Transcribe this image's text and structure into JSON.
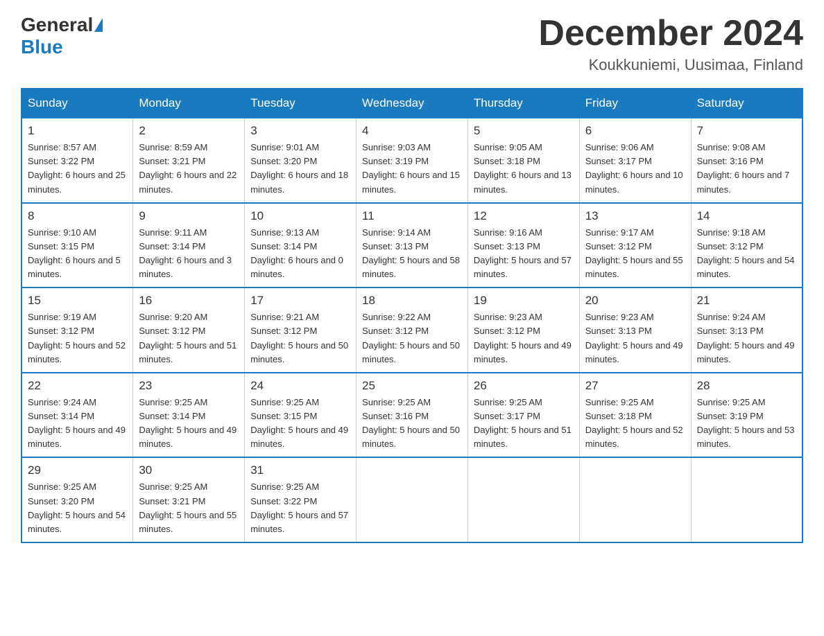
{
  "header": {
    "logo": {
      "general": "General",
      "blue": "Blue"
    },
    "title": "December 2024",
    "location": "Koukkuniemi, Uusimaa, Finland"
  },
  "days_of_week": [
    "Sunday",
    "Monday",
    "Tuesday",
    "Wednesday",
    "Thursday",
    "Friday",
    "Saturday"
  ],
  "weeks": [
    [
      {
        "day": "1",
        "sunrise": "8:57 AM",
        "sunset": "3:22 PM",
        "daylight": "6 hours and 25 minutes."
      },
      {
        "day": "2",
        "sunrise": "8:59 AM",
        "sunset": "3:21 PM",
        "daylight": "6 hours and 22 minutes."
      },
      {
        "day": "3",
        "sunrise": "9:01 AM",
        "sunset": "3:20 PM",
        "daylight": "6 hours and 18 minutes."
      },
      {
        "day": "4",
        "sunrise": "9:03 AM",
        "sunset": "3:19 PM",
        "daylight": "6 hours and 15 minutes."
      },
      {
        "day": "5",
        "sunrise": "9:05 AM",
        "sunset": "3:18 PM",
        "daylight": "6 hours and 13 minutes."
      },
      {
        "day": "6",
        "sunrise": "9:06 AM",
        "sunset": "3:17 PM",
        "daylight": "6 hours and 10 minutes."
      },
      {
        "day": "7",
        "sunrise": "9:08 AM",
        "sunset": "3:16 PM",
        "daylight": "6 hours and 7 minutes."
      }
    ],
    [
      {
        "day": "8",
        "sunrise": "9:10 AM",
        "sunset": "3:15 PM",
        "daylight": "6 hours and 5 minutes."
      },
      {
        "day": "9",
        "sunrise": "9:11 AM",
        "sunset": "3:14 PM",
        "daylight": "6 hours and 3 minutes."
      },
      {
        "day": "10",
        "sunrise": "9:13 AM",
        "sunset": "3:14 PM",
        "daylight": "6 hours and 0 minutes."
      },
      {
        "day": "11",
        "sunrise": "9:14 AM",
        "sunset": "3:13 PM",
        "daylight": "5 hours and 58 minutes."
      },
      {
        "day": "12",
        "sunrise": "9:16 AM",
        "sunset": "3:13 PM",
        "daylight": "5 hours and 57 minutes."
      },
      {
        "day": "13",
        "sunrise": "9:17 AM",
        "sunset": "3:12 PM",
        "daylight": "5 hours and 55 minutes."
      },
      {
        "day": "14",
        "sunrise": "9:18 AM",
        "sunset": "3:12 PM",
        "daylight": "5 hours and 54 minutes."
      }
    ],
    [
      {
        "day": "15",
        "sunrise": "9:19 AM",
        "sunset": "3:12 PM",
        "daylight": "5 hours and 52 minutes."
      },
      {
        "day": "16",
        "sunrise": "9:20 AM",
        "sunset": "3:12 PM",
        "daylight": "5 hours and 51 minutes."
      },
      {
        "day": "17",
        "sunrise": "9:21 AM",
        "sunset": "3:12 PM",
        "daylight": "5 hours and 50 minutes."
      },
      {
        "day": "18",
        "sunrise": "9:22 AM",
        "sunset": "3:12 PM",
        "daylight": "5 hours and 50 minutes."
      },
      {
        "day": "19",
        "sunrise": "9:23 AM",
        "sunset": "3:12 PM",
        "daylight": "5 hours and 49 minutes."
      },
      {
        "day": "20",
        "sunrise": "9:23 AM",
        "sunset": "3:13 PM",
        "daylight": "5 hours and 49 minutes."
      },
      {
        "day": "21",
        "sunrise": "9:24 AM",
        "sunset": "3:13 PM",
        "daylight": "5 hours and 49 minutes."
      }
    ],
    [
      {
        "day": "22",
        "sunrise": "9:24 AM",
        "sunset": "3:14 PM",
        "daylight": "5 hours and 49 minutes."
      },
      {
        "day": "23",
        "sunrise": "9:25 AM",
        "sunset": "3:14 PM",
        "daylight": "5 hours and 49 minutes."
      },
      {
        "day": "24",
        "sunrise": "9:25 AM",
        "sunset": "3:15 PM",
        "daylight": "5 hours and 49 minutes."
      },
      {
        "day": "25",
        "sunrise": "9:25 AM",
        "sunset": "3:16 PM",
        "daylight": "5 hours and 50 minutes."
      },
      {
        "day": "26",
        "sunrise": "9:25 AM",
        "sunset": "3:17 PM",
        "daylight": "5 hours and 51 minutes."
      },
      {
        "day": "27",
        "sunrise": "9:25 AM",
        "sunset": "3:18 PM",
        "daylight": "5 hours and 52 minutes."
      },
      {
        "day": "28",
        "sunrise": "9:25 AM",
        "sunset": "3:19 PM",
        "daylight": "5 hours and 53 minutes."
      }
    ],
    [
      {
        "day": "29",
        "sunrise": "9:25 AM",
        "sunset": "3:20 PM",
        "daylight": "5 hours and 54 minutes."
      },
      {
        "day": "30",
        "sunrise": "9:25 AM",
        "sunset": "3:21 PM",
        "daylight": "5 hours and 55 minutes."
      },
      {
        "day": "31",
        "sunrise": "9:25 AM",
        "sunset": "3:22 PM",
        "daylight": "5 hours and 57 minutes."
      },
      null,
      null,
      null,
      null
    ]
  ]
}
